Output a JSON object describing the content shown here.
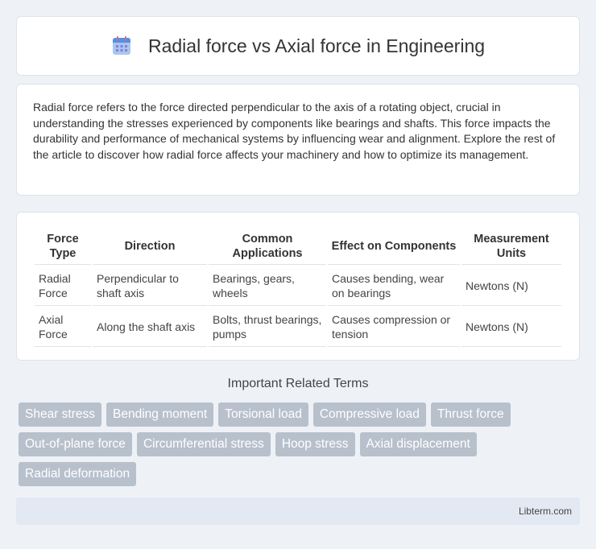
{
  "header": {
    "title": "Radial force vs Axial force in Engineering",
    "icon": "calendar-icon"
  },
  "intro": {
    "text": "Radial force refers to the force directed perpendicular to the axis of a rotating object, crucial in understanding the stresses experienced by components like bearings and shafts. This force impacts the durability and performance of mechanical systems by influencing wear and alignment. Explore the rest of the article to discover how radial force affects your machinery and how to optimize its management."
  },
  "table": {
    "headers": [
      "Force Type",
      "Direction",
      "Common Applications",
      "Effect on Components",
      "Measurement Units"
    ],
    "rows": [
      [
        "Radial Force",
        "Perpendicular to shaft axis",
        "Bearings, gears, wheels",
        "Causes bending, wear on bearings",
        "Newtons (N)"
      ],
      [
        "Axial Force",
        "Along the shaft axis",
        "Bolts, thrust bearings, pumps",
        "Causes compression or tension",
        "Newtons (N)"
      ]
    ]
  },
  "related": {
    "title": "Important Related Terms",
    "tags": [
      "Shear stress",
      "Bending moment",
      "Torsional load",
      "Compressive load",
      "Thrust force",
      "Out-of-plane force",
      "Circumferential stress",
      "Hoop stress",
      "Axial displacement",
      "Radial deformation"
    ]
  },
  "footer": {
    "text": "Libterm.com"
  }
}
